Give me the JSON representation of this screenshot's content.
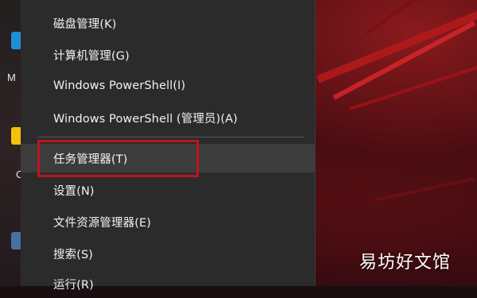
{
  "desktop": {
    "icon_labels": [
      "M",
      "C"
    ]
  },
  "context_menu": {
    "items": [
      {
        "label": "磁盘管理(K)"
      },
      {
        "label": "计算机管理(G)"
      },
      {
        "label": "Windows PowerShell(I)"
      },
      {
        "label": "Windows PowerShell (管理员)(A)"
      },
      {
        "label": "任务管理器(T)"
      },
      {
        "label": "设置(N)"
      },
      {
        "label": "文件资源管理器(E)"
      },
      {
        "label": "搜索(S)"
      },
      {
        "label": "运行(R)"
      }
    ],
    "highlighted_item": "任务管理器(T)"
  },
  "watermark": {
    "text": "易坊好文馆"
  },
  "colors": {
    "menu_bg": "#2b2b2b",
    "hover_bg": "#3c3c3c",
    "annotation_red": "#c0141b"
  }
}
